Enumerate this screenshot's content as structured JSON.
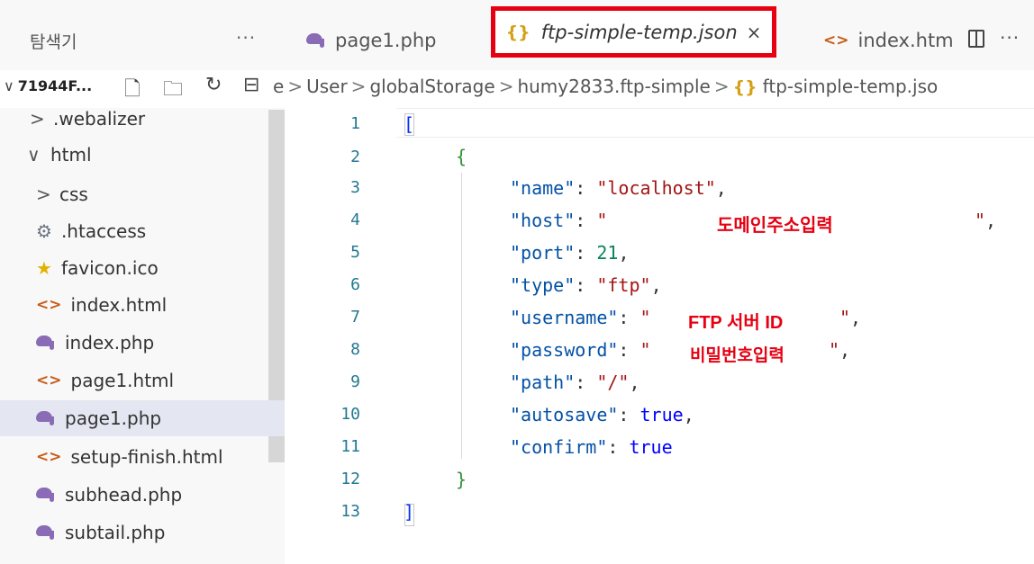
{
  "explorer": {
    "title": "탐색기",
    "more": "···",
    "folder_label": "71944F...",
    "items": [
      {
        "label": ".webalizer",
        "kind": "folder-collapsed"
      },
      {
        "label": "html",
        "kind": "folder-expanded"
      },
      {
        "label": "css",
        "kind": "folder-collapsed"
      },
      {
        "label": ".htaccess",
        "kind": "gear"
      },
      {
        "label": "favicon.ico",
        "kind": "star"
      },
      {
        "label": "index.html",
        "kind": "html"
      },
      {
        "label": "index.php",
        "kind": "php"
      },
      {
        "label": "page1.html",
        "kind": "html"
      },
      {
        "label": "page1.php",
        "kind": "php",
        "selected": true
      },
      {
        "label": "setup-finish.html",
        "kind": "html"
      },
      {
        "label": "subhead.php",
        "kind": "php"
      },
      {
        "label": "subtail.php",
        "kind": "php"
      }
    ]
  },
  "tabs": [
    {
      "label": "page1.php",
      "icon": "php-elephant-icon"
    },
    {
      "label": "ftp-simple-temp.json",
      "icon": "json-braces-icon",
      "active": true,
      "close": "×"
    },
    {
      "label": "index.htm",
      "icon": "html-code-icon"
    }
  ],
  "editor_more": "···",
  "breadcrumb": [
    "e",
    "User",
    "globalStorage",
    "humy2833.ftp-simple",
    "ftp-simple-temp.jso"
  ],
  "breadcrumb_sep": ">",
  "gutter": [
    "1",
    "2",
    "3",
    "4",
    "5",
    "6",
    "7",
    "8",
    "9",
    "10",
    "11",
    "12",
    "13"
  ],
  "code": {
    "open_bracket": "[",
    "open_brace": "{",
    "name_key": "\"name\"",
    "name_val": "\"localhost\"",
    "host_key": "\"host\"",
    "host_val_open": "\"",
    "host_val_close": "\"",
    "port_key": "\"port\"",
    "port_val": "21",
    "type_key": "\"type\"",
    "type_val": "\"ftp\"",
    "user_key": "\"username\"",
    "user_val_open": "\"",
    "user_val_close": "\"",
    "pass_key": "\"password\"",
    "pass_val_open": "\"",
    "pass_val_close": "\"",
    "path_key": "\"path\"",
    "path_val": "\"/\"",
    "autosave_key": "\"autosave\"",
    "autosave_val": "true",
    "confirm_key": "\"confirm\"",
    "confirm_val": "true",
    "close_brace": "}",
    "close_bracket": "]"
  },
  "annotations": {
    "domain": "도메인주소입력",
    "ftp_id": "FTP 서버 ID",
    "password": "비밀번호입력",
    "color": "#e60012"
  },
  "highlight_color": "#e60012"
}
